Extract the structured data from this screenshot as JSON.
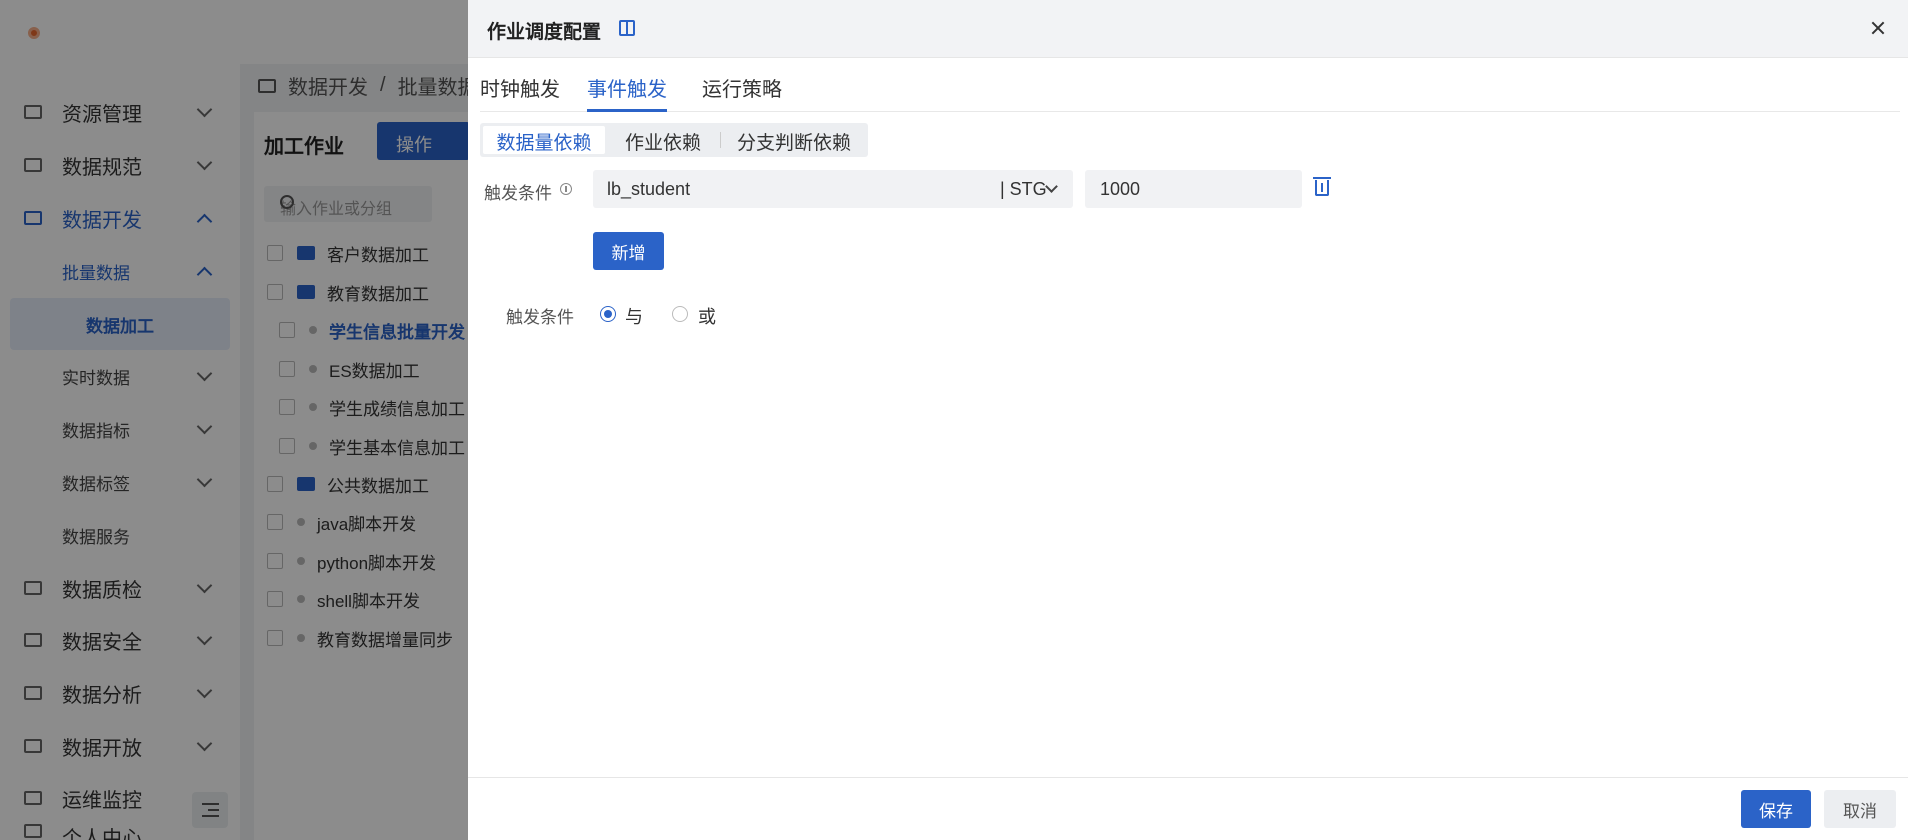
{
  "sidebar": {
    "items": [
      {
        "label": "资源管理",
        "icon": "resource-icon"
      },
      {
        "label": "数据规范",
        "icon": "standard-icon"
      },
      {
        "label": "数据开发",
        "icon": "develop-icon"
      },
      {
        "label": "批量数据"
      },
      {
        "label": "数据加工"
      },
      {
        "label": "实时数据"
      },
      {
        "label": "数据指标"
      },
      {
        "label": "数据标签"
      },
      {
        "label": "数据服务"
      },
      {
        "label": "数据质检",
        "icon": "quality-icon"
      },
      {
        "label": "数据安全",
        "icon": "security-icon"
      },
      {
        "label": "数据分析",
        "icon": "analysis-icon"
      },
      {
        "label": "数据开放",
        "icon": "open-icon"
      },
      {
        "label": "运维监控",
        "icon": "monitor-icon"
      },
      {
        "label": "个人中心",
        "icon": "user-icon"
      }
    ]
  },
  "breadcrumb": {
    "part1": "数据开发",
    "separator": "/",
    "part2": "批量数据"
  },
  "panel": {
    "title": "加工作业",
    "op_button": "操作",
    "search_placeholder": "输入作业或分组"
  },
  "tree": [
    {
      "label": "客户数据加工"
    },
    {
      "label": "教育数据加工"
    },
    {
      "label": "学生信息批量开发"
    },
    {
      "label": "ES数据加工"
    },
    {
      "label": "学生成绩信息加工"
    },
    {
      "label": "学生基本信息加工"
    },
    {
      "label": "公共数据加工"
    },
    {
      "label": "java脚本开发"
    },
    {
      "label": "python脚本开发"
    },
    {
      "label": "shell脚本开发"
    },
    {
      "label": "教育数据增量同步"
    }
  ],
  "drawer": {
    "title": "作业调度配置",
    "tabs": [
      {
        "label": "时钟触发"
      },
      {
        "label": "事件触发"
      },
      {
        "label": "运行策略"
      }
    ],
    "active_tab": "事件触发",
    "segments": [
      {
        "label": "数据量依赖"
      },
      {
        "label": "作业依赖"
      },
      {
        "label": "分支判断依赖"
      }
    ],
    "condition": {
      "label": "触发条件",
      "table": "lb_student",
      "source": "| STG",
      "threshold": "1000"
    },
    "add_button": "新增",
    "logic": {
      "label": "触发条件",
      "option_and": "与",
      "option_or": "或",
      "selected": "与"
    },
    "footer": {
      "save": "保存",
      "cancel": "取消"
    }
  },
  "colors": {
    "accent": "#2b63c8",
    "mask": "rgba(0,0,0,0.45)"
  }
}
